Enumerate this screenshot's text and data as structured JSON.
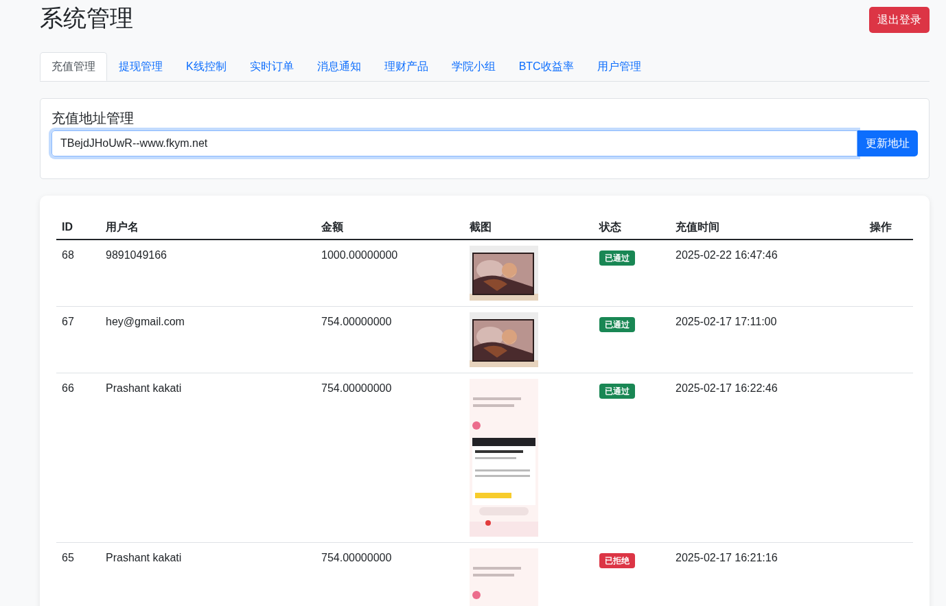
{
  "header": {
    "title": "系统管理",
    "logout_button": "退出登录"
  },
  "tabs": [
    {
      "label": "充值管理",
      "selected": true
    },
    {
      "label": "提现管理",
      "selected": false
    },
    {
      "label": "K线控制",
      "selected": false
    },
    {
      "label": "实时订单",
      "selected": false
    },
    {
      "label": "消息通知",
      "selected": false
    },
    {
      "label": "理财产品",
      "selected": false
    },
    {
      "label": "学院小组",
      "selected": false
    },
    {
      "label": "BTC收益率",
      "selected": false
    },
    {
      "label": "用户管理",
      "selected": false
    }
  ],
  "address_card": {
    "title": "充值地址管理",
    "value": "TBejdJHoUwR--www.fkym.net",
    "button": "更新地址"
  },
  "table": {
    "columns": [
      "ID",
      "用户名",
      "金额",
      "截图",
      "状态",
      "充值时间",
      "操作"
    ],
    "rows": [
      {
        "id": "68",
        "username": "9891049166",
        "amount": "1000.00000000",
        "status": {
          "text": "已通过",
          "kind": "approved"
        },
        "time": "2025-02-22 16:47:46"
      },
      {
        "id": "67",
        "username": "hey@gmail.com",
        "amount": "754.00000000",
        "status": {
          "text": "已通过",
          "kind": "approved"
        },
        "time": "2025-02-17 17:11:00"
      },
      {
        "id": "66",
        "username": "Prashant kakati",
        "amount": "754.00000000",
        "status": {
          "text": "已通过",
          "kind": "approved"
        },
        "time": "2025-02-17 16:22:46"
      },
      {
        "id": "65",
        "username": "Prashant kakati",
        "amount": "754.00000000",
        "status": {
          "text": "已拒绝",
          "kind": "rejected"
        },
        "time": "2025-02-17 16:21:16"
      }
    ]
  }
}
